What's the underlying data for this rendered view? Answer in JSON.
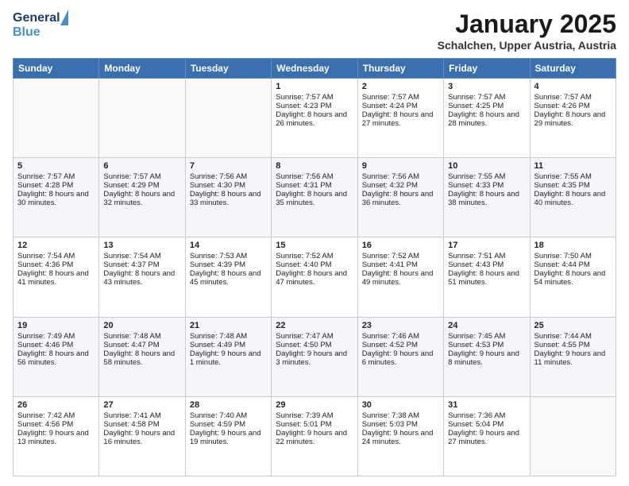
{
  "header": {
    "logo_general": "General",
    "logo_blue": "Blue",
    "month_title": "January 2025",
    "location": "Schalchen, Upper Austria, Austria"
  },
  "weekdays": [
    "Sunday",
    "Monday",
    "Tuesday",
    "Wednesday",
    "Thursday",
    "Friday",
    "Saturday"
  ],
  "weeks": [
    [
      {
        "day": "",
        "content": ""
      },
      {
        "day": "",
        "content": ""
      },
      {
        "day": "",
        "content": ""
      },
      {
        "day": "1",
        "content": "Sunrise: 7:57 AM\nSunset: 4:23 PM\nDaylight: 8 hours and 26 minutes."
      },
      {
        "day": "2",
        "content": "Sunrise: 7:57 AM\nSunset: 4:24 PM\nDaylight: 8 hours and 27 minutes."
      },
      {
        "day": "3",
        "content": "Sunrise: 7:57 AM\nSunset: 4:25 PM\nDaylight: 8 hours and 28 minutes."
      },
      {
        "day": "4",
        "content": "Sunrise: 7:57 AM\nSunset: 4:26 PM\nDaylight: 8 hours and 29 minutes."
      }
    ],
    [
      {
        "day": "5",
        "content": "Sunrise: 7:57 AM\nSunset: 4:28 PM\nDaylight: 8 hours and 30 minutes."
      },
      {
        "day": "6",
        "content": "Sunrise: 7:57 AM\nSunset: 4:29 PM\nDaylight: 8 hours and 32 minutes."
      },
      {
        "day": "7",
        "content": "Sunrise: 7:56 AM\nSunset: 4:30 PM\nDaylight: 8 hours and 33 minutes."
      },
      {
        "day": "8",
        "content": "Sunrise: 7:56 AM\nSunset: 4:31 PM\nDaylight: 8 hours and 35 minutes."
      },
      {
        "day": "9",
        "content": "Sunrise: 7:56 AM\nSunset: 4:32 PM\nDaylight: 8 hours and 36 minutes."
      },
      {
        "day": "10",
        "content": "Sunrise: 7:55 AM\nSunset: 4:33 PM\nDaylight: 8 hours and 38 minutes."
      },
      {
        "day": "11",
        "content": "Sunrise: 7:55 AM\nSunset: 4:35 PM\nDaylight: 8 hours and 40 minutes."
      }
    ],
    [
      {
        "day": "12",
        "content": "Sunrise: 7:54 AM\nSunset: 4:36 PM\nDaylight: 8 hours and 41 minutes."
      },
      {
        "day": "13",
        "content": "Sunrise: 7:54 AM\nSunset: 4:37 PM\nDaylight: 8 hours and 43 minutes."
      },
      {
        "day": "14",
        "content": "Sunrise: 7:53 AM\nSunset: 4:39 PM\nDaylight: 8 hours and 45 minutes."
      },
      {
        "day": "15",
        "content": "Sunrise: 7:52 AM\nSunset: 4:40 PM\nDaylight: 8 hours and 47 minutes."
      },
      {
        "day": "16",
        "content": "Sunrise: 7:52 AM\nSunset: 4:41 PM\nDaylight: 8 hours and 49 minutes."
      },
      {
        "day": "17",
        "content": "Sunrise: 7:51 AM\nSunset: 4:43 PM\nDaylight: 8 hours and 51 minutes."
      },
      {
        "day": "18",
        "content": "Sunrise: 7:50 AM\nSunset: 4:44 PM\nDaylight: 8 hours and 54 minutes."
      }
    ],
    [
      {
        "day": "19",
        "content": "Sunrise: 7:49 AM\nSunset: 4:46 PM\nDaylight: 8 hours and 56 minutes."
      },
      {
        "day": "20",
        "content": "Sunrise: 7:48 AM\nSunset: 4:47 PM\nDaylight: 8 hours and 58 minutes."
      },
      {
        "day": "21",
        "content": "Sunrise: 7:48 AM\nSunset: 4:49 PM\nDaylight: 9 hours and 1 minute."
      },
      {
        "day": "22",
        "content": "Sunrise: 7:47 AM\nSunset: 4:50 PM\nDaylight: 9 hours and 3 minutes."
      },
      {
        "day": "23",
        "content": "Sunrise: 7:46 AM\nSunset: 4:52 PM\nDaylight: 9 hours and 6 minutes."
      },
      {
        "day": "24",
        "content": "Sunrise: 7:45 AM\nSunset: 4:53 PM\nDaylight: 9 hours and 8 minutes."
      },
      {
        "day": "25",
        "content": "Sunrise: 7:44 AM\nSunset: 4:55 PM\nDaylight: 9 hours and 11 minutes."
      }
    ],
    [
      {
        "day": "26",
        "content": "Sunrise: 7:42 AM\nSunset: 4:56 PM\nDaylight: 9 hours and 13 minutes."
      },
      {
        "day": "27",
        "content": "Sunrise: 7:41 AM\nSunset: 4:58 PM\nDaylight: 9 hours and 16 minutes."
      },
      {
        "day": "28",
        "content": "Sunrise: 7:40 AM\nSunset: 4:59 PM\nDaylight: 9 hours and 19 minutes."
      },
      {
        "day": "29",
        "content": "Sunrise: 7:39 AM\nSunset: 5:01 PM\nDaylight: 9 hours and 22 minutes."
      },
      {
        "day": "30",
        "content": "Sunrise: 7:38 AM\nSunset: 5:03 PM\nDaylight: 9 hours and 24 minutes."
      },
      {
        "day": "31",
        "content": "Sunrise: 7:36 AM\nSunset: 5:04 PM\nDaylight: 9 hours and 27 minutes."
      },
      {
        "day": "",
        "content": ""
      }
    ]
  ]
}
